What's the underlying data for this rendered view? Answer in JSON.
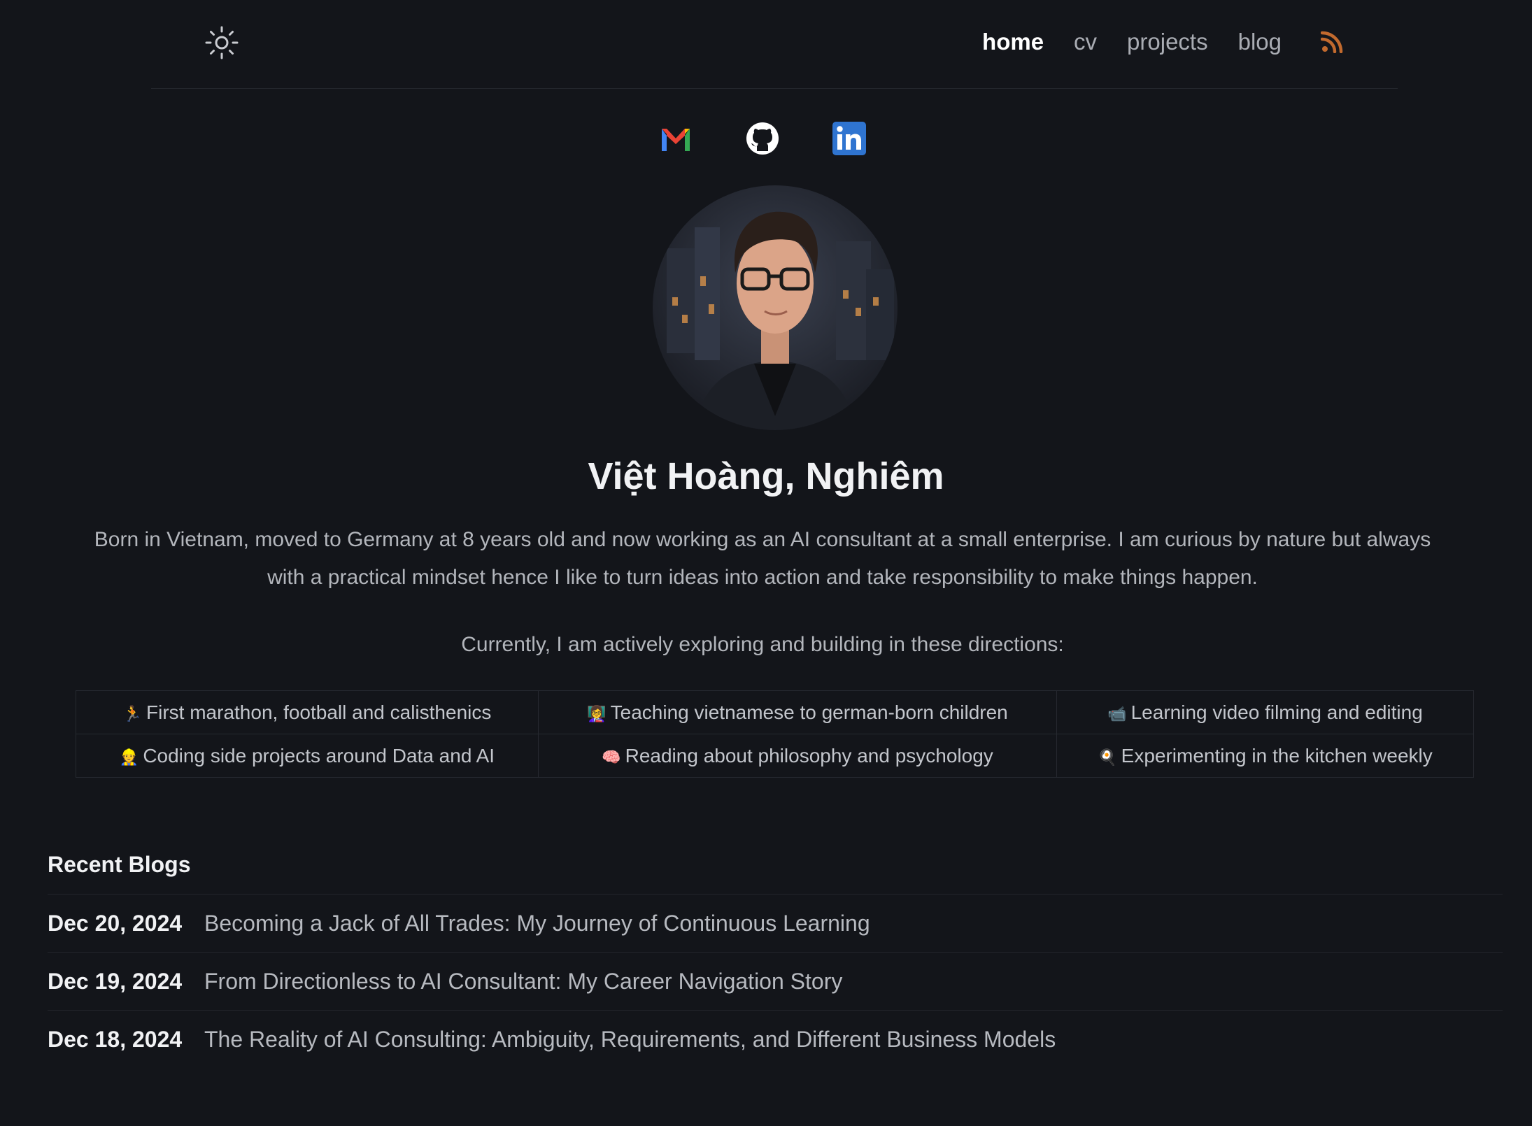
{
  "header": {
    "theme_icon": "sun-icon",
    "nav": [
      {
        "label": "home",
        "active": true
      },
      {
        "label": "cv",
        "active": false
      },
      {
        "label": "projects",
        "active": false
      },
      {
        "label": "blog",
        "active": false
      }
    ],
    "rss_icon": "rss-icon",
    "colors": {
      "rss": "#c26a2e",
      "active": "#ffffff",
      "background": "#13151a"
    }
  },
  "socials": [
    {
      "icon": "gmail-icon"
    },
    {
      "icon": "github-icon"
    },
    {
      "icon": "linkedin-icon"
    }
  ],
  "profile": {
    "name": "Việt Hoàng, Nghiêm",
    "bio": "Born in Vietnam, moved to Germany at 8 years old and now working as an AI consultant at a small enterprise. I am curious by nature but always with a practical mindset hence I like to turn ideas into action and take responsibility to make things happen.",
    "intro": "Currently, I am actively exploring and building in these directions:"
  },
  "interests": [
    [
      {
        "emoji": "🏃",
        "text": "First marathon, football and calisthenics"
      },
      {
        "emoji": "👩‍🏫",
        "text": "Teaching vietnamese to german-born children"
      },
      {
        "emoji": "📹",
        "text": "Learning video filming and editing"
      }
    ],
    [
      {
        "emoji": "👷",
        "text": "Coding side projects around Data and AI"
      },
      {
        "emoji": "🧠",
        "text": "Reading about philosophy and psychology"
      },
      {
        "emoji": "🍳",
        "text": "Experimenting in the kitchen weekly"
      }
    ]
  ],
  "recent_blogs": {
    "title": "Recent Blogs",
    "items": [
      {
        "date": "Dec 20, 2024",
        "title": "Becoming a Jack of All Trades: My Journey of Continuous Learning"
      },
      {
        "date": "Dec 19, 2024",
        "title": "From Directionless to AI Consultant: My Career Navigation Story"
      },
      {
        "date": "Dec 18, 2024",
        "title": "The Reality of AI Consulting: Ambiguity, Requirements, and Different Business Models"
      }
    ]
  }
}
